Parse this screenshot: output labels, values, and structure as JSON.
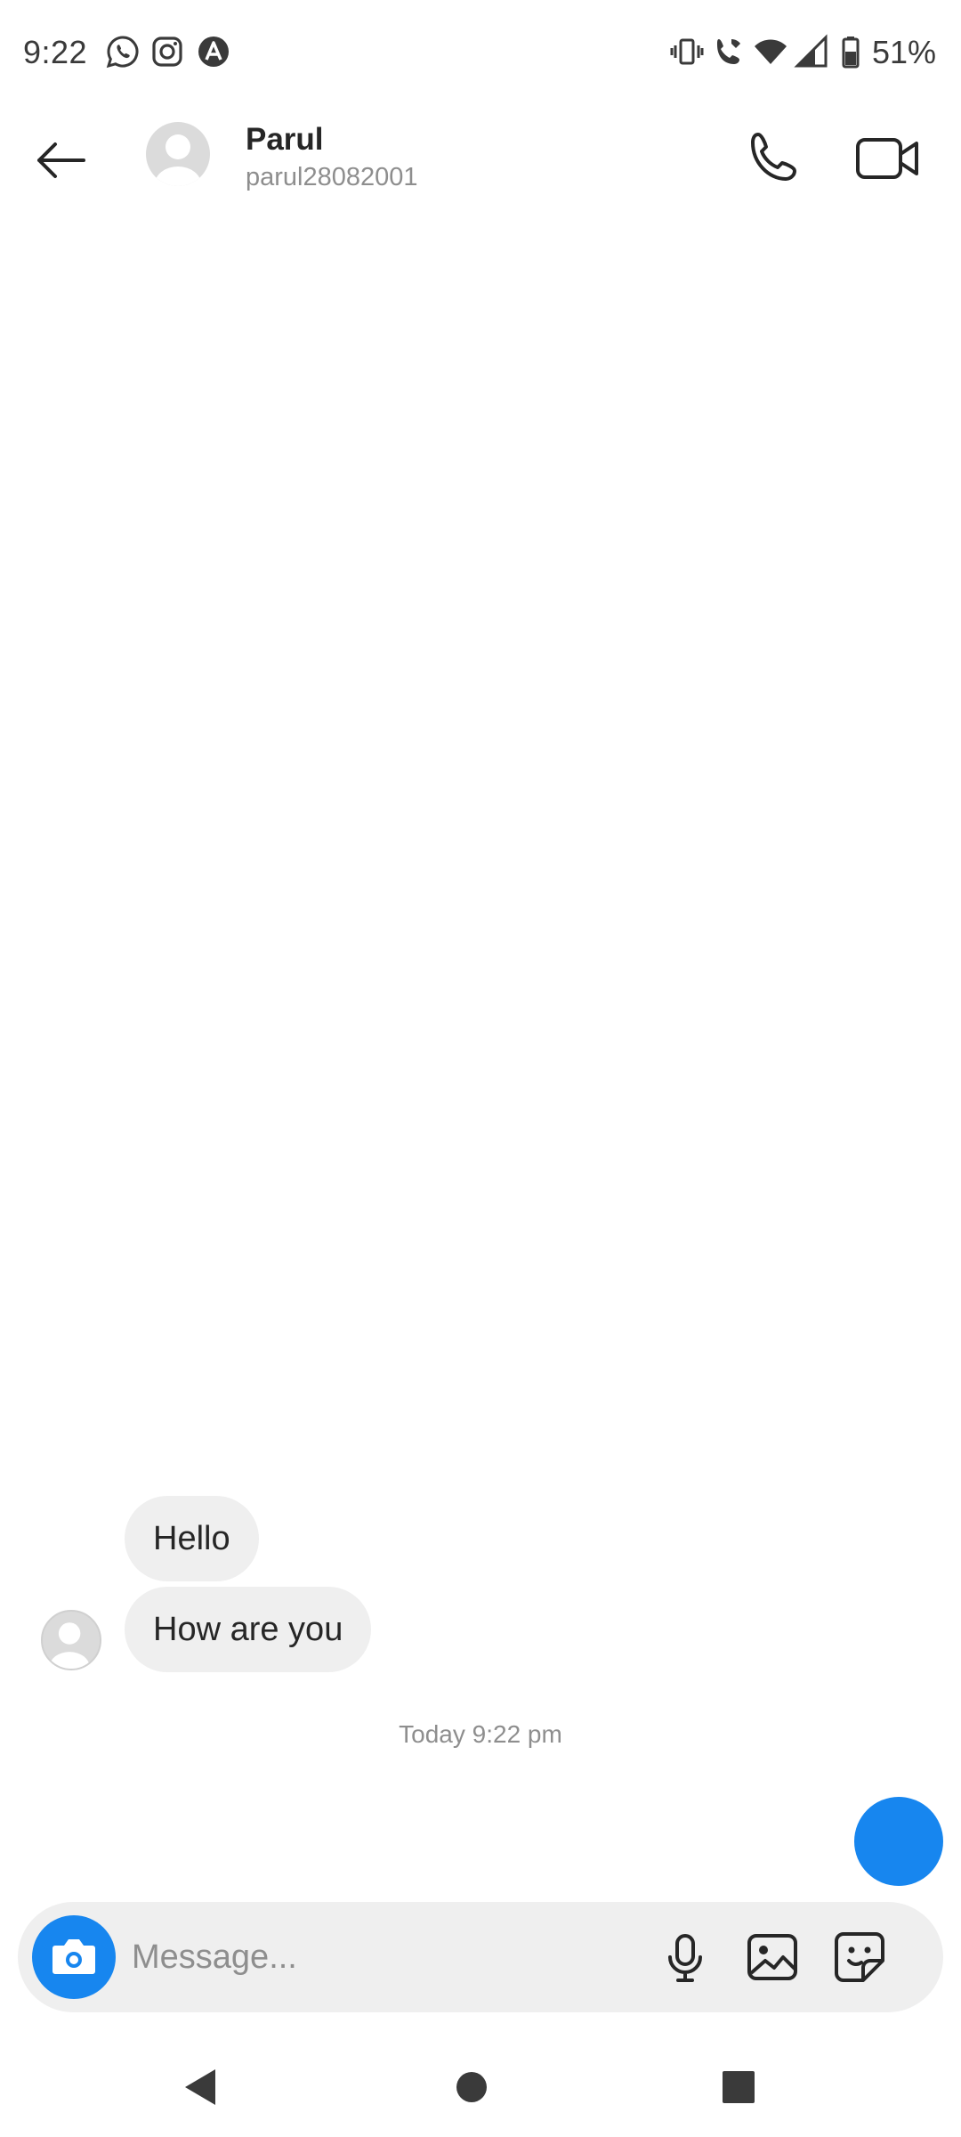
{
  "status_bar": {
    "time": "9:22",
    "battery": "51%",
    "left_icons": [
      "whatsapp-icon",
      "instagram-icon",
      "assistant-icon"
    ],
    "right_icons": [
      "vibrate-icon",
      "wifi-call-icon",
      "wifi-icon",
      "signal-icon",
      "battery-icon"
    ]
  },
  "header": {
    "contact_name": "Parul",
    "contact_handle": "parul28082001"
  },
  "messages": [
    {
      "text": "Hello",
      "from": "contact"
    },
    {
      "text": "How are you",
      "from": "contact"
    }
  ],
  "timestamp": "Today 9:22 pm",
  "composer": {
    "placeholder": "Message..."
  },
  "colors": {
    "accent": "#1786ef",
    "bubble": "#efefef",
    "muted": "#8e8e8e"
  }
}
